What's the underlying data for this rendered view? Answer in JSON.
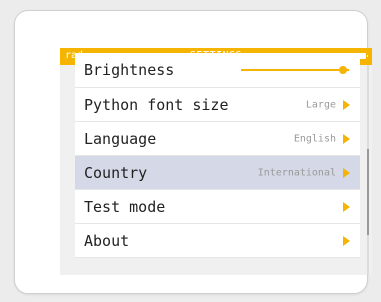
{
  "header": {
    "angle_unit": "rad",
    "title": "SETTINGS",
    "battery_icon": "battery-full-icon"
  },
  "settings": {
    "brightness": {
      "label": "Brightness",
      "level": 0.94
    },
    "items": [
      {
        "label": "Python font size",
        "value": "Large"
      },
      {
        "label": "Language",
        "value": "English"
      },
      {
        "label": "Country",
        "value": "International",
        "selected": true
      },
      {
        "label": "Test mode",
        "value": ""
      },
      {
        "label": "About",
        "value": ""
      }
    ]
  },
  "colors": {
    "accent": "#f5b400",
    "selected_row": "#d5d8e6",
    "screen_bg": "#f0f0f0"
  },
  "scroll": {
    "position": 0.6
  }
}
